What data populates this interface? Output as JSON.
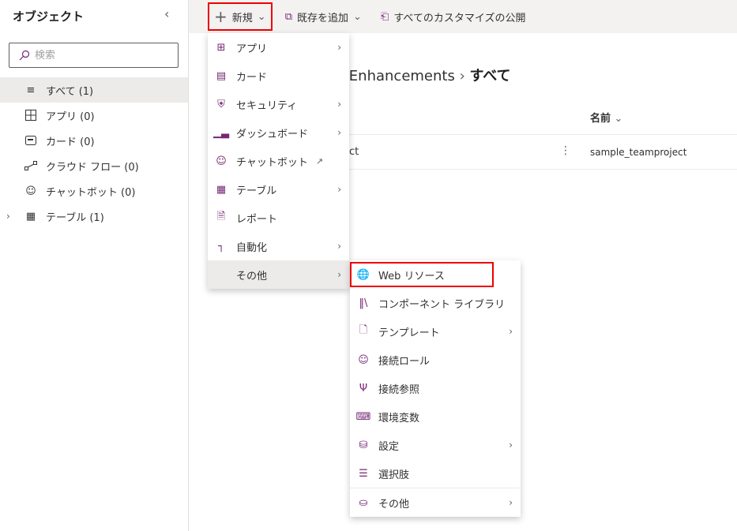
{
  "sidebar": {
    "title": "オブジェクト",
    "search_placeholder": "検索",
    "items": [
      {
        "label": "すべて (1)",
        "icon": "list-icon"
      },
      {
        "label": "アプリ (0)",
        "icon": "app-icon"
      },
      {
        "label": "カード (0)",
        "icon": "card-icon"
      },
      {
        "label": "クラウド フロー (0)",
        "icon": "flow-icon"
      },
      {
        "label": "チャットボット (0)",
        "icon": "bot-icon"
      },
      {
        "label": "テーブル (1)",
        "icon": "table-icon"
      }
    ]
  },
  "toolbar": {
    "new_label": "新規",
    "add_existing_label": "既存を追加",
    "publish_label": "すべてのカスタマイズの公開"
  },
  "breadcrumb": {
    "parent": "e Enhancements",
    "current": "すべて"
  },
  "table": {
    "column_name": "名前",
    "rows": [
      {
        "display": "ct",
        "name": "sample_teamproject"
      }
    ]
  },
  "new_menu": [
    {
      "label": "アプリ",
      "submenu": true
    },
    {
      "label": "カード"
    },
    {
      "label": "セキュリティ",
      "submenu": true
    },
    {
      "label": "ダッシュボード",
      "submenu": true
    },
    {
      "label": "チャットボット",
      "external": true
    },
    {
      "label": "テーブル",
      "submenu": true
    },
    {
      "label": "レポート"
    },
    {
      "label": "自動化",
      "submenu": true
    },
    {
      "label": "その他",
      "submenu": true
    }
  ],
  "other_menu": [
    {
      "label": "Web リソース"
    },
    {
      "label": "コンポーネント ライブラリ"
    },
    {
      "label": "テンプレート",
      "submenu": true
    },
    {
      "label": "接続ロール"
    },
    {
      "label": "接続参照"
    },
    {
      "label": "環境変数"
    },
    {
      "label": "設定",
      "submenu": true
    },
    {
      "label": "選択肢"
    },
    {
      "label": "その他",
      "submenu": true
    }
  ],
  "colors": {
    "accent": "#742774",
    "highlight": "#e00000",
    "toolbar_bg": "#f3f2f1"
  }
}
